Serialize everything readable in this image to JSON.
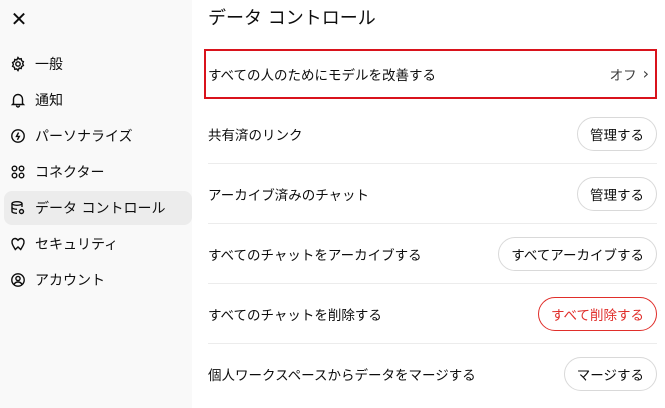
{
  "sidebar": {
    "close_icon": "close-icon",
    "items": [
      {
        "label": "一般",
        "icon": "gear-icon"
      },
      {
        "label": "通知",
        "icon": "bell-icon"
      },
      {
        "label": "パーソナライズ",
        "icon": "personalize-icon"
      },
      {
        "label": "コネクター",
        "icon": "connector-icon"
      },
      {
        "label": "データ コントロール",
        "icon": "database-icon",
        "active": true
      },
      {
        "label": "セキュリティ",
        "icon": "shield-icon"
      },
      {
        "label": "アカウント",
        "icon": "user-icon"
      }
    ]
  },
  "main": {
    "title": "データ コントロール",
    "rows": [
      {
        "label": "すべての人のためにモデルを改善する",
        "value": "オフ",
        "type": "toggle-link"
      },
      {
        "label": "共有済のリンク",
        "button": "管理する",
        "type": "button"
      },
      {
        "label": "アーカイブ済みのチャット",
        "button": "管理する",
        "type": "button"
      },
      {
        "label": "すべてのチャットをアーカイブする",
        "button": "すべてアーカイブする",
        "type": "button"
      },
      {
        "label": "すべてのチャットを削除する",
        "button": "すべて削除する",
        "type": "danger"
      },
      {
        "label": "個人ワークスペースからデータをマージする",
        "button": "マージする",
        "type": "button"
      }
    ]
  },
  "colors": {
    "sidebar_bg": "#f9f9f9",
    "active_item_bg": "#ececec",
    "highlight_border": "#d9131c",
    "danger": "#e02e2a"
  }
}
